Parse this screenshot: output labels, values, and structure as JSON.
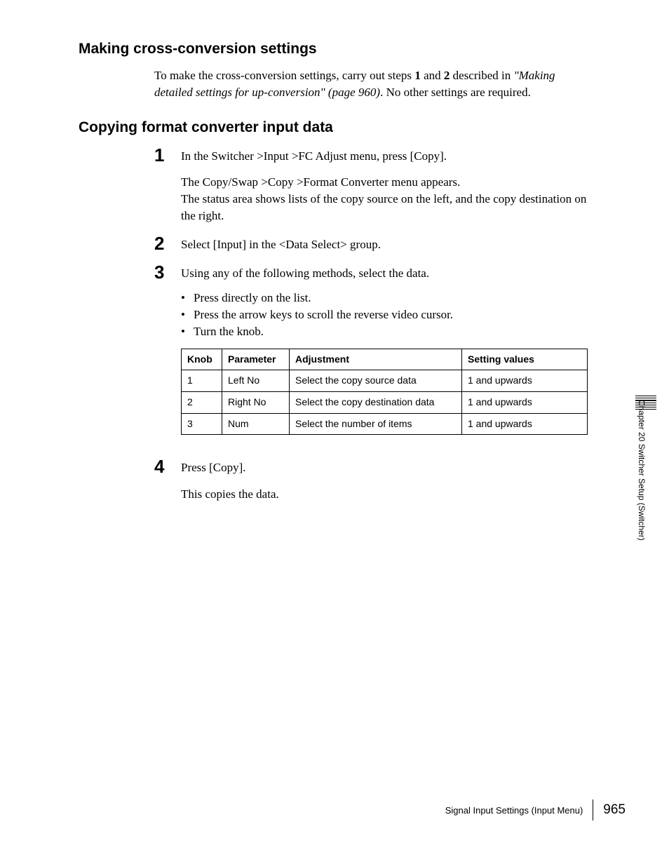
{
  "section1": {
    "heading": "Making cross-conversion settings",
    "para_prefix": "To make the cross-conversion settings, carry out steps ",
    "step_a": "1",
    "mid1": " and ",
    "step_b": "2",
    "mid2": " described in ",
    "ref": "\"Making detailed settings for up-conversion\" (page 960)",
    "suffix": ". No other settings are required."
  },
  "section2": {
    "heading": "Copying format converter input data",
    "steps": [
      {
        "num": "1",
        "line1": "In the Switcher >Input >FC Adjust menu, press [Copy].",
        "para2a": "The Copy/Swap >Copy >Format Converter menu appears.",
        "para2b": "The status area shows lists of the copy source on the left, and the copy destination on the right."
      },
      {
        "num": "2",
        "line1": "Select [Input] in the <Data Select> group."
      },
      {
        "num": "3",
        "line1": "Using any of the following methods, select the data.",
        "bullets": [
          "Press directly on the list.",
          "Press the arrow keys to scroll the reverse video cursor.",
          "Turn the knob."
        ]
      },
      {
        "num": "4",
        "line1": "Press [Copy].",
        "para2a": "This copies the data."
      }
    ]
  },
  "table": {
    "headers": [
      "Knob",
      "Parameter",
      "Adjustment",
      "Setting values"
    ],
    "rows": [
      [
        "1",
        "Left No",
        "Select the copy source data",
        "1 and upwards"
      ],
      [
        "2",
        "Right No",
        "Select the copy destination data",
        "1 and upwards"
      ],
      [
        "3",
        "Num",
        "Select the number of items",
        "1 and upwards"
      ]
    ]
  },
  "footer": {
    "section": "Signal Input Settings (Input Menu)",
    "page": "965"
  },
  "side": {
    "chapter": "Chapter 20  Switcher Setup (Switcher)"
  }
}
